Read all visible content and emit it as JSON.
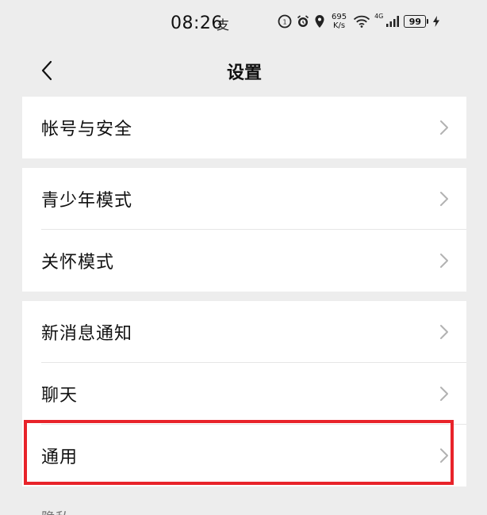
{
  "status_bar": {
    "time": "08:26",
    "carrier_glyph": "支",
    "net_speed_value": "695",
    "net_speed_unit": "K/s",
    "network_type": "4G",
    "battery": "99"
  },
  "nav": {
    "title": "设置"
  },
  "groups": [
    {
      "items": [
        {
          "label": "帐号与安全"
        }
      ]
    },
    {
      "items": [
        {
          "label": "青少年模式"
        },
        {
          "label": "关怀模式"
        }
      ]
    },
    {
      "items": [
        {
          "label": "新消息通知"
        },
        {
          "label": "聊天"
        },
        {
          "label": "通用"
        }
      ]
    }
  ],
  "partial_next_item": "隐私",
  "highlight_color": "#e8232a"
}
